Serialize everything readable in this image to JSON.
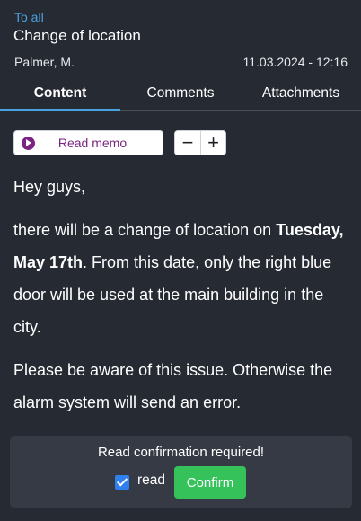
{
  "header": {
    "recipient": "To all",
    "subject": "Change of location",
    "author": "Palmer, M.",
    "datetime": "11.03.2024 - 12:16"
  },
  "tabs": [
    {
      "label": "Content",
      "active": true
    },
    {
      "label": "Comments",
      "active": false
    },
    {
      "label": "Attachments",
      "active": false
    }
  ],
  "toolbar": {
    "memo_label": "Read memo",
    "zoom_out": "−",
    "zoom_in": "+"
  },
  "message": {
    "greeting": "Hey guys,",
    "p2_before": "there will be a change of location on ",
    "p2_bold": "Tuesday, May 17th",
    "p2_after": ". From this date, only the right blue door will be used at the main building in the city.",
    "p3": "Please be aware of this issue. Otherwise the alarm system will send an error."
  },
  "confirmation": {
    "title": "Read confirmation required!",
    "checkbox_label": "read",
    "checked": true,
    "button_label": "Confirm"
  },
  "colors": {
    "background": "#262a33",
    "accent": "#4aa3df",
    "memo_purple": "#7b2482",
    "confirm_green": "#35c25b",
    "checkbox_blue": "#2f80ed"
  }
}
